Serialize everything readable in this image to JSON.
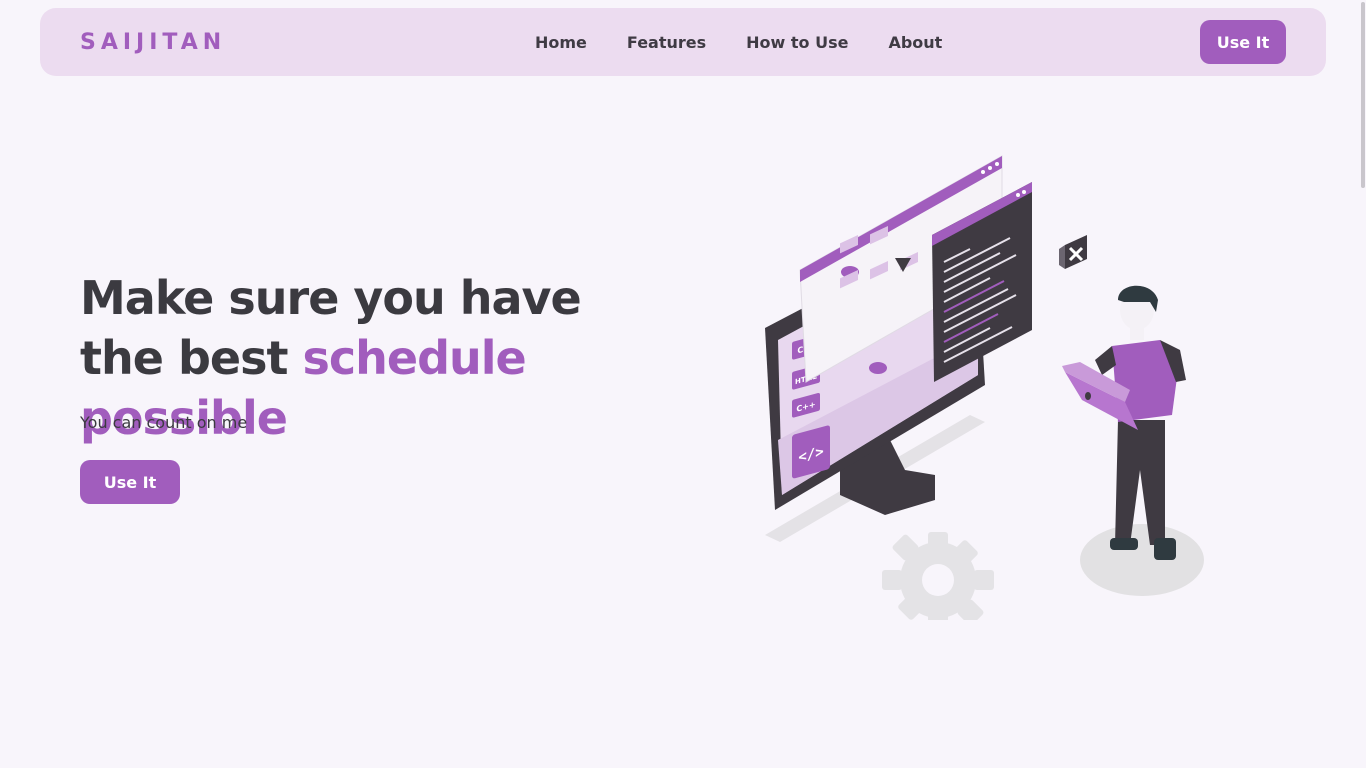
{
  "brand": {
    "logo": "SAIJITAN"
  },
  "nav": {
    "links": [
      "Home",
      "Features",
      "How to Use",
      "About"
    ],
    "cta_label": "Use It"
  },
  "hero": {
    "title_part1": "Make sure you have the best ",
    "title_accent": "schedule possible",
    "subtitle": "You can count on me",
    "cta_label": "Use It"
  },
  "illustration": {
    "screen_tags": [
      "CSS",
      "HTML",
      "C++"
    ],
    "code_symbol": "</>",
    "icons": [
      "monitor-icon",
      "code-window-icon",
      "laptop-person-icon",
      "gear-icon",
      "close-icon"
    ]
  },
  "colors": {
    "accent": "#a15dbd",
    "navbar_bg": "#ecdcf0",
    "page_bg": "#f8f5fb",
    "text_dark": "#3b3a40"
  }
}
